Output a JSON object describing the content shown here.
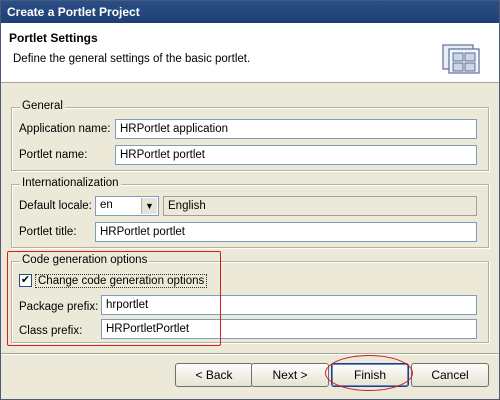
{
  "window": {
    "title": "Create a Portlet Project"
  },
  "header": {
    "title": "Portlet Settings",
    "description": "Define the general settings of the basic portlet.",
    "icon": "portlet-wizard-icon"
  },
  "general": {
    "legend": "General",
    "app_name_label": "Application name:",
    "app_name_value": "HRPortlet application",
    "portlet_name_label": "Portlet name:",
    "portlet_name_value": "HRPortlet portlet"
  },
  "i18n": {
    "legend": "Internationalization",
    "default_locale_label": "Default locale:",
    "locale_value": "en",
    "locale_display": "English",
    "portlet_title_label": "Portlet title:",
    "portlet_title_value": "HRPortlet portlet"
  },
  "codegen": {
    "legend": "Code generation options",
    "checkbox_label": "Change code generation options",
    "checked": true,
    "package_prefix_label": "Package prefix:",
    "package_prefix_value": "hrportlet",
    "class_prefix_label": "Class prefix:",
    "class_prefix_value": "HRPortletPortlet"
  },
  "buttons": {
    "back": "< Back",
    "next": "Next >",
    "finish": "Finish",
    "cancel": "Cancel"
  },
  "colors": {
    "annotation": "#d21d1d",
    "titlebar": "#1f3f72",
    "dialog_bg": "#ece9d8"
  }
}
